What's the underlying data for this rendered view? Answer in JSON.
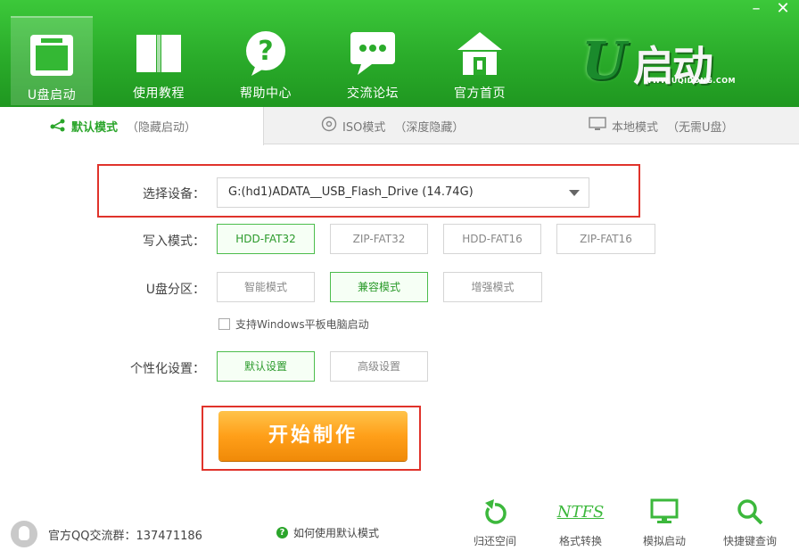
{
  "window": {
    "minimize": "–",
    "close": "✕"
  },
  "nav": [
    {
      "label": "U盘启动",
      "icon": "usb-window-icon"
    },
    {
      "label": "使用教程",
      "icon": "book-icon"
    },
    {
      "label": "帮助中心",
      "icon": "help-bubble-icon"
    },
    {
      "label": "交流论坛",
      "icon": "chat-bubble-icon"
    },
    {
      "label": "官方首页",
      "icon": "home-icon"
    }
  ],
  "logo": {
    "mark": "U",
    "name": "启动",
    "url": "WWW.UQIDONG.COM"
  },
  "tabs": [
    {
      "main": "默认模式",
      "sub": "（隐藏启动）",
      "icon": "branch-icon"
    },
    {
      "main": "ISO模式",
      "sub": "（深度隐藏）",
      "icon": "disc-icon"
    },
    {
      "main": "本地模式",
      "sub": "（无需U盘）",
      "icon": "monitor-icon"
    }
  ],
  "form": {
    "device_label": "选择设备：",
    "device_value": "G:(hd1)ADATA__USB_Flash_Drive (14.74G)",
    "write_label": "写入模式：",
    "write_options": [
      "HDD-FAT32",
      "ZIP-FAT32",
      "HDD-FAT16",
      "ZIP-FAT16"
    ],
    "write_selected": "HDD-FAT32",
    "partition_label": "U盘分区：",
    "partition_options": [
      "智能模式",
      "兼容模式",
      "增强模式"
    ],
    "partition_selected": "兼容模式",
    "tablet_checkbox": "支持Windows平板电脑启动",
    "tablet_checked": false,
    "personal_label": "个性化设置：",
    "personal_options": [
      "默认设置",
      "高级设置"
    ],
    "personal_selected": "默认设置",
    "start_button": "开始制作"
  },
  "footer": {
    "qq_group": "官方QQ交流群：137471186",
    "help_link": "如何使用默认模式",
    "tools": [
      {
        "label": "归还空间",
        "icon": "restore-icon"
      },
      {
        "label": "格式转换",
        "icon": "ntfs-icon",
        "icon_text": "NTFS"
      },
      {
        "label": "模拟启动",
        "icon": "monitor-icon"
      },
      {
        "label": "快捷键查询",
        "icon": "search-icon"
      }
    ]
  },
  "colors": {
    "brand_green": "#2aab2a",
    "start_orange": "#ff9f19",
    "highlight_red": "#e0332b"
  }
}
